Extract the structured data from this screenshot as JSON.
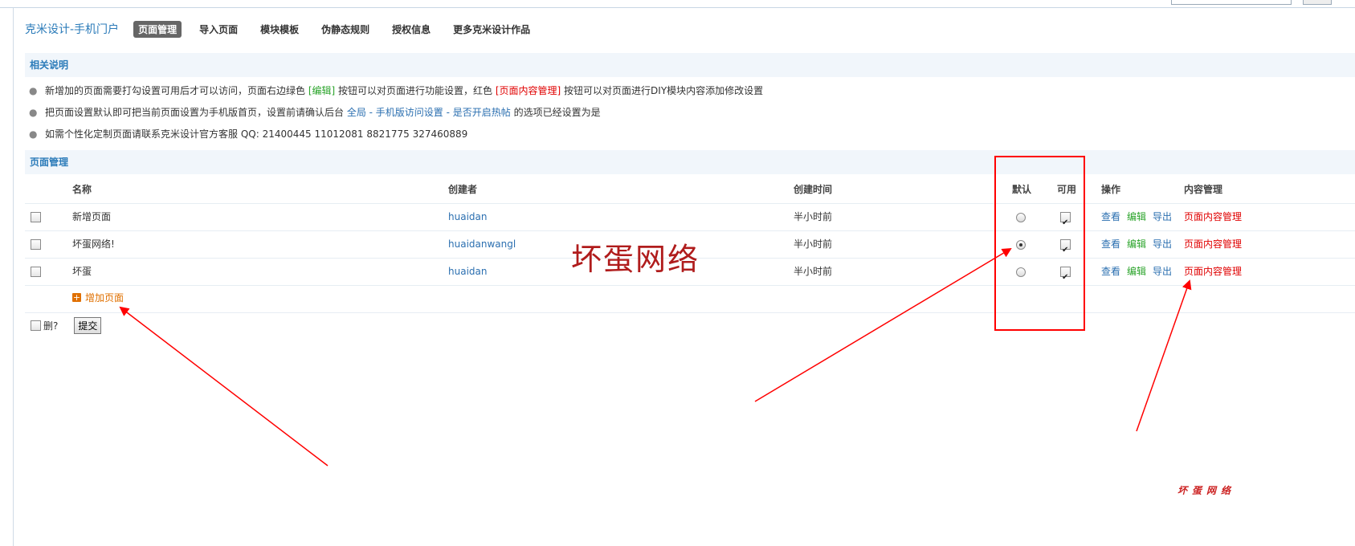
{
  "nav": {
    "brand": "克米设计-手机门户",
    "tabs": [
      {
        "label": "页面管理",
        "active": true
      },
      {
        "label": "导入页面",
        "active": false
      },
      {
        "label": "模块模板",
        "active": false
      },
      {
        "label": "伪静态规则",
        "active": false
      },
      {
        "label": "授权信息",
        "active": false
      },
      {
        "label": "更多克米设计作品",
        "active": false
      }
    ]
  },
  "notes": {
    "title": "相关说明",
    "line1": {
      "a": "新增加的页面需要打勾设置可用后才可以访问，页面右边绿色 ",
      "green": "[编辑]",
      "b": " 按钮可以对页面进行功能设置，红色 ",
      "red": "[页面内容管理]",
      "c": " 按钮可以对页面进行DIY模块内容添加修改设置"
    },
    "line2": {
      "a": "把页面设置默认即可把当前页面设置为手机版首页，设置前请确认后台 ",
      "link": "全局 - 手机版访问设置 - 是否开启热帖",
      "b": " 的选项已经设置为是"
    },
    "line3": "如需个性化定制页面请联系克米设计官方客服 QQ: 21400445 11012081 8821775 327460889"
  },
  "table": {
    "title": "页面管理",
    "headers": {
      "name": "名称",
      "creator": "创建者",
      "time": "创建时间",
      "default": "默认",
      "enabled": "可用",
      "ops": "操作",
      "content": "内容管理"
    },
    "rows": [
      {
        "name": "新增页面",
        "creator": "huaidan",
        "time": "半小时前",
        "is_default": false,
        "enabled": true
      },
      {
        "name": "坏蛋网络!",
        "creator": "huaidanwangl",
        "time": "半小时前",
        "is_default": true,
        "enabled": true
      },
      {
        "name": "坏蛋",
        "creator": "huaidan",
        "time": "半小时前",
        "is_default": false,
        "enabled": true
      }
    ],
    "op_view": "查看",
    "op_edit": "编辑",
    "op_export": "导出",
    "content_link": "页面内容管理",
    "add_page": "增加页面",
    "delete_label": "删?",
    "submit_label": "提交"
  },
  "watermark_big": "坏蛋网络",
  "watermark_small": "坏蛋网络",
  "colors": {
    "link_blue": "#2b6fb0",
    "edit_green": "#29a329",
    "content_red": "#e00000",
    "add_orange": "#e07000",
    "annotation_red": "#ff0000"
  }
}
